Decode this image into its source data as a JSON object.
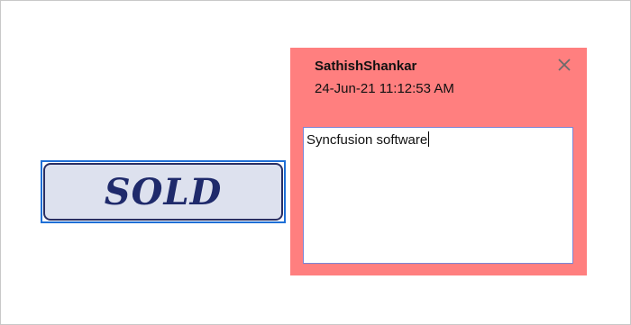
{
  "stamp": {
    "text": "SOLD",
    "fill_color": "#dde1ee",
    "text_color": "#1f2a6b",
    "selection_color": "#1f6fd6"
  },
  "comment_popup": {
    "author": "SathishShankar",
    "date": "24-Jun-21 11:12:53 AM",
    "close_icon": "close-icon",
    "note_text": "Syncfusion software",
    "background_color": "#ff7f7f"
  }
}
